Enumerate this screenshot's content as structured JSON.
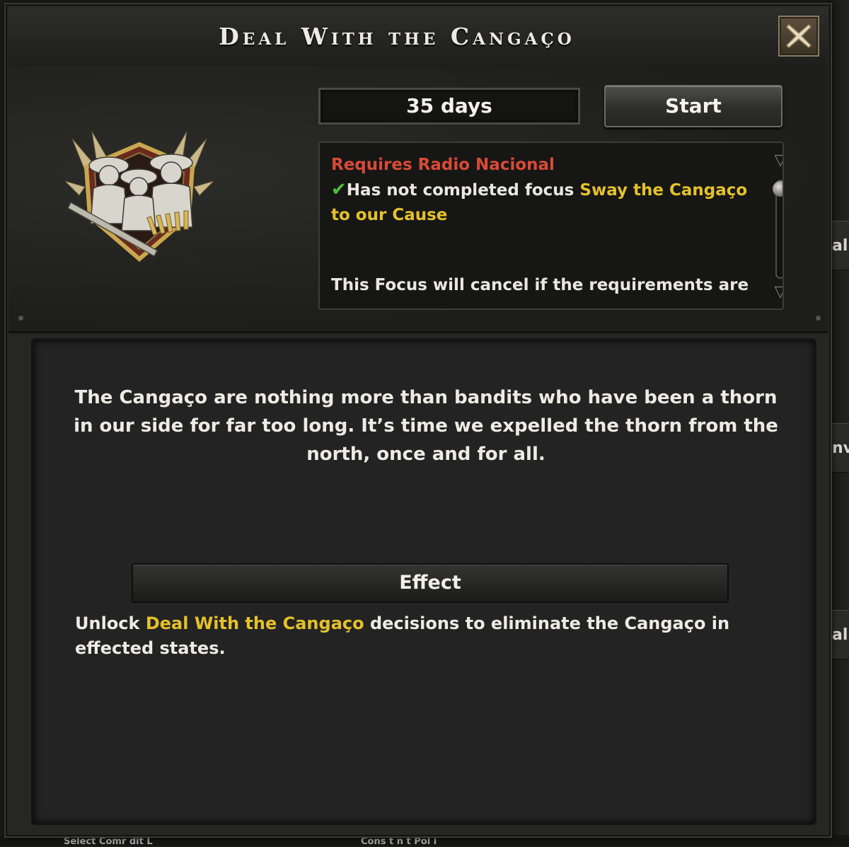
{
  "window": {
    "title": "Deal With the Cangaço",
    "close_icon": "close-x-icon"
  },
  "focus": {
    "duration": "35 days",
    "start_label": "Start",
    "emblem_icon": "cangaceiros-bandits-emblem-icon"
  },
  "requirements": {
    "requires_label": "Requires Radio Nacional",
    "check_icon": "checkmark-icon",
    "condition_prefix": "Has not completed focus ",
    "condition_focus": "Sway the Cangaço to our Cause",
    "footer": "This Focus will cancel if the requirements are",
    "colors": {
      "red": "#d94a36",
      "yellow": "#e4c12a",
      "check": "#4fbf3a"
    }
  },
  "description": "The Cangaço are nothing more than bandits who have been a thorn in our side for far too long. It’s time we expelled the thorn from the north, once and for all.",
  "effect": {
    "header": "Effect",
    "prefix": "Unlock ",
    "highlight": "Deal With the Cangaço",
    "suffix": " decisions to eliminate the Cangaço in effected states."
  },
  "background": {
    "edge_fragments": [
      "al",
      "nv",
      "al"
    ],
    "bottom_fragments": [
      "Select Comr  dit  L  ",
      "Cons  t  n  t  Pol  i  "
    ]
  }
}
